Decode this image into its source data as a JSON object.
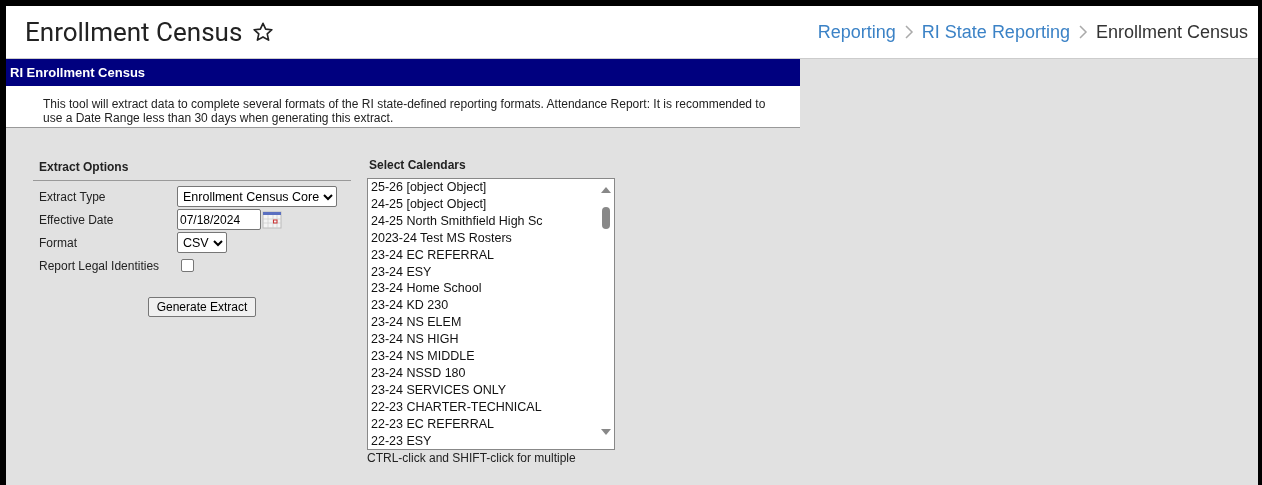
{
  "header": {
    "title": "Enrollment Census",
    "favorite": false,
    "breadcrumbs": [
      {
        "label": "Reporting",
        "kind": "link"
      },
      {
        "label": "RI State Reporting",
        "kind": "link"
      },
      {
        "label": "Enrollment Census",
        "kind": "current"
      }
    ]
  },
  "panel": {
    "title": "RI Enrollment Census",
    "description": "This tool will extract data to complete several formats of the RI state-defined reporting formats. Attendance Report: It is recommended to use a Date Range less than 30 days when generating this extract."
  },
  "extract_options": {
    "heading": "Extract Options",
    "fields": [
      {
        "kind": "select",
        "label": "Extract Type",
        "value": "Enrollment Census Core"
      },
      {
        "kind": "date",
        "label": "Effective Date",
        "value": "07/18/2024"
      },
      {
        "kind": "select",
        "label": "Format",
        "value": "CSV"
      },
      {
        "kind": "checkbox",
        "label": "Report Legal Identities",
        "checked": false
      }
    ],
    "button": "Generate Extract"
  },
  "calendars": {
    "heading": "Select Calendars",
    "hint": "CTRL-click and SHIFT-click for multiple",
    "items": [
      {
        "label": "25-26 [object Object]",
        "selected": false
      },
      {
        "label": "24-25 [object Object]",
        "selected": false
      },
      {
        "label": "24-25 North Smithfield High Sc",
        "selected": false
      },
      {
        "label": "2023-24 Test MS Rosters",
        "selected": false
      },
      {
        "label": "23-24 EC REFERRAL",
        "selected": false
      },
      {
        "label": "23-24 ESY",
        "selected": false
      },
      {
        "label": "23-24 Home School",
        "selected": false
      },
      {
        "label": "23-24 KD 230",
        "selected": false
      },
      {
        "label": "23-24 NS ELEM",
        "selected": false
      },
      {
        "label": "23-24 NS HIGH",
        "selected": false
      },
      {
        "label": "23-24 NS MIDDLE",
        "selected": false
      },
      {
        "label": "23-24 NSSD 180",
        "selected": false
      },
      {
        "label": "23-24 SERVICES ONLY",
        "selected": false
      },
      {
        "label": "22-23 CHARTER-TECHNICAL",
        "selected": false
      },
      {
        "label": "22-23 EC REFERRAL",
        "selected": false
      },
      {
        "label": "22-23 ESY",
        "selected": false
      }
    ]
  }
}
